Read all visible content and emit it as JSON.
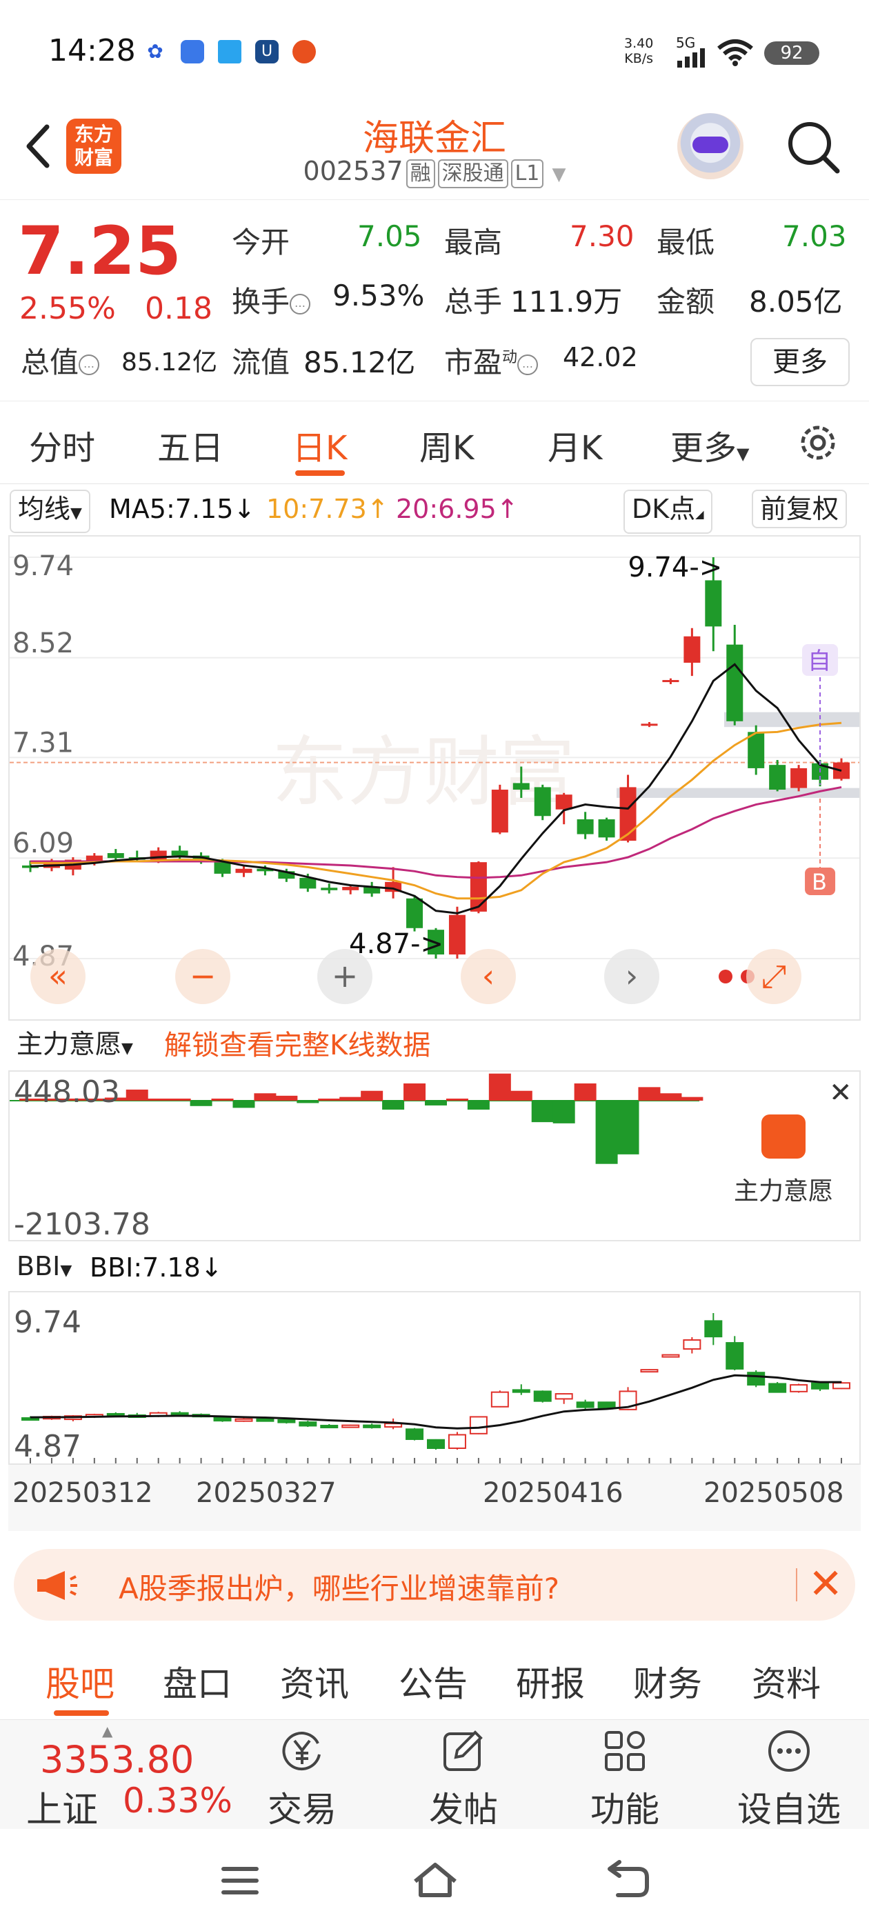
{
  "status_bar": {
    "time": "14:28",
    "net_speed": "3.40",
    "net_unit": "KB/s",
    "network": "5G",
    "battery": "92"
  },
  "header": {
    "logo_text": "东方财富",
    "stock_name": "海联金汇",
    "stock_code": "002537",
    "tags": [
      "融",
      "深股通",
      "L1"
    ]
  },
  "quote": {
    "price": "7.25",
    "change_pct": "2.55%",
    "change_amt": "0.18",
    "items": [
      {
        "label": "今开",
        "value": "7.05",
        "color": "green"
      },
      {
        "label": "最高",
        "value": "7.30",
        "color": "red"
      },
      {
        "label": "最低",
        "value": "7.03",
        "color": "green"
      },
      {
        "label": "换手",
        "value": "9.53%",
        "color": "black"
      },
      {
        "label": "总手",
        "value": "111.9万",
        "color": "black"
      },
      {
        "label": "金额",
        "value": "8.05亿",
        "color": "black"
      },
      {
        "label": "总值",
        "value": "85.12亿",
        "color": "black"
      },
      {
        "label": "流值",
        "value": "85.12亿",
        "color": "black"
      },
      {
        "label": "市盈",
        "value": "42.02",
        "color": "black"
      }
    ],
    "pe_superscript": "动",
    "more_label": "更多"
  },
  "period_tabs": [
    "分时",
    "五日",
    "日K",
    "周K",
    "月K",
    "更多"
  ],
  "active_period": "日K",
  "ma_row": {
    "selector": "均线",
    "ma5": "MA5:7.15",
    "ma10": "10:7.73",
    "ma20": "20:6.95",
    "dk_label": "DK点",
    "adjust_label": "前复权"
  },
  "colors": {
    "up": "#e0302a",
    "down": "#1f9a2a",
    "accent": "#f2581e",
    "ma5": "#111111",
    "ma10": "#f0a020",
    "ma20": "#c0287a"
  },
  "kline": {
    "y_labels": [
      "9.74",
      "8.52",
      "7.31",
      "6.09",
      "4.87"
    ],
    "high_marker": "9.74->",
    "low_marker": "4.87->",
    "watermark": "东方财富",
    "marker_zi": "自",
    "marker_b": "B",
    "controls": [
      "«",
      "−",
      "+",
      "‹",
      "›",
      "⤢"
    ]
  },
  "flow": {
    "selector": "主力意愿",
    "unlock_text": "解锁查看完整K线数据",
    "top_value": "448.03",
    "bottom_value": "-2103.78",
    "side_label": "主力意愿"
  },
  "bbi": {
    "selector": "BBI",
    "value": "BBI:7.18",
    "top_value": "9.74",
    "bottom_value": "4.87"
  },
  "dates": [
    "20250312",
    "20250327",
    "20250416",
    "20250508"
  ],
  "banner": {
    "text": "A股季报出炉，哪些行业增速靠前?"
  },
  "bottom_tabs": [
    "股吧",
    "盘口",
    "资讯",
    "公告",
    "研报",
    "财务",
    "资料"
  ],
  "index": {
    "value": "3353.80",
    "name": "上证",
    "change_pct": "0.33%"
  },
  "bottom_nav": [
    "交易",
    "发帖",
    "功能",
    "设自选"
  ],
  "chart_data": {
    "type": "candlestick",
    "ylim": [
      4.87,
      9.74
    ],
    "candles": [
      {
        "o": 6.0,
        "h": 6.06,
        "l": 5.92,
        "c": 5.97
      },
      {
        "o": 5.97,
        "h": 6.08,
        "l": 5.93,
        "c": 6.05
      },
      {
        "o": 5.95,
        "h": 6.1,
        "l": 5.88,
        "c": 6.07
      },
      {
        "o": 6.06,
        "h": 6.15,
        "l": 6.0,
        "c": 6.12
      },
      {
        "o": 6.15,
        "h": 6.2,
        "l": 6.06,
        "c": 6.09
      },
      {
        "o": 6.1,
        "h": 6.18,
        "l": 6.04,
        "c": 6.07
      },
      {
        "o": 6.07,
        "h": 6.22,
        "l": 6.03,
        "c": 6.18
      },
      {
        "o": 6.18,
        "h": 6.24,
        "l": 6.08,
        "c": 6.12
      },
      {
        "o": 6.12,
        "h": 6.16,
        "l": 6.02,
        "c": 6.06
      },
      {
        "o": 6.05,
        "h": 6.08,
        "l": 5.86,
        "c": 5.9
      },
      {
        "o": 5.91,
        "h": 6.0,
        "l": 5.86,
        "c": 5.96
      },
      {
        "o": 5.96,
        "h": 6.0,
        "l": 5.88,
        "c": 5.93
      },
      {
        "o": 5.93,
        "h": 5.96,
        "l": 5.8,
        "c": 5.84
      },
      {
        "o": 5.85,
        "h": 5.9,
        "l": 5.68,
        "c": 5.72
      },
      {
        "o": 5.73,
        "h": 5.78,
        "l": 5.66,
        "c": 5.7
      },
      {
        "o": 5.7,
        "h": 5.76,
        "l": 5.65,
        "c": 5.74
      },
      {
        "o": 5.74,
        "h": 5.8,
        "l": 5.62,
        "c": 5.66
      },
      {
        "o": 5.68,
        "h": 5.98,
        "l": 5.6,
        "c": 5.8
      },
      {
        "o": 5.6,
        "h": 5.64,
        "l": 5.2,
        "c": 5.24
      },
      {
        "o": 5.22,
        "h": 5.24,
        "l": 4.87,
        "c": 4.92
      },
      {
        "o": 4.92,
        "h": 5.5,
        "l": 4.87,
        "c": 5.4
      },
      {
        "o": 5.44,
        "h": 6.05,
        "l": 5.42,
        "c": 6.04
      },
      {
        "o": 6.4,
        "h": 6.98,
        "l": 6.38,
        "c": 6.92
      },
      {
        "o": 7.0,
        "h": 7.2,
        "l": 6.82,
        "c": 6.92
      },
      {
        "o": 6.95,
        "h": 6.98,
        "l": 6.55,
        "c": 6.6
      },
      {
        "o": 6.68,
        "h": 6.88,
        "l": 6.5,
        "c": 6.86
      },
      {
        "o": 6.56,
        "h": 6.65,
        "l": 6.32,
        "c": 6.38
      },
      {
        "o": 6.56,
        "h": 6.58,
        "l": 6.3,
        "c": 6.34
      },
      {
        "o": 6.3,
        "h": 7.1,
        "l": 6.28,
        "c": 6.95
      },
      {
        "o": 7.7,
        "h": 7.74,
        "l": 7.68,
        "c": 7.72
      },
      {
        "o": 8.23,
        "h": 8.27,
        "l": 8.2,
        "c": 8.25
      },
      {
        "o": 8.46,
        "h": 8.88,
        "l": 8.3,
        "c": 8.78
      },
      {
        "o": 9.46,
        "h": 9.74,
        "l": 8.6,
        "c": 8.9
      },
      {
        "o": 8.68,
        "h": 8.92,
        "l": 7.7,
        "c": 7.75
      },
      {
        "o": 7.62,
        "h": 7.7,
        "l": 7.1,
        "c": 7.18
      },
      {
        "o": 7.22,
        "h": 7.28,
        "l": 6.9,
        "c": 6.92
      },
      {
        "o": 6.94,
        "h": 7.22,
        "l": 6.9,
        "c": 7.18
      },
      {
        "o": 7.24,
        "h": 7.28,
        "l": 6.96,
        "c": 7.04
      },
      {
        "o": 7.05,
        "h": 7.3,
        "l": 7.03,
        "c": 7.25
      }
    ],
    "ma5": [
      5.99,
      6.0,
      6.01,
      6.03,
      6.06,
      6.08,
      6.1,
      6.11,
      6.1,
      6.05,
      6.0,
      5.97,
      5.92,
      5.86,
      5.8,
      5.76,
      5.74,
      5.72,
      5.63,
      5.45,
      5.42,
      5.5,
      5.75,
      6.08,
      6.39,
      6.67,
      6.74,
      6.71,
      6.69,
      6.96,
      7.32,
      7.75,
      8.24,
      8.44,
      8.12,
      7.91,
      7.52,
      7.22,
      7.15
    ],
    "ma10": [
      6.03,
      6.03,
      6.03,
      6.04,
      6.05,
      6.05,
      6.06,
      6.07,
      6.07,
      6.06,
      6.05,
      6.03,
      6.01,
      5.98,
      5.94,
      5.9,
      5.86,
      5.82,
      5.76,
      5.66,
      5.6,
      5.6,
      5.62,
      5.7,
      5.9,
      6.04,
      6.11,
      6.21,
      6.38,
      6.6,
      6.84,
      7.04,
      7.27,
      7.46,
      7.61,
      7.62,
      7.67,
      7.71,
      7.73
    ],
    "ma20": [
      6.05,
      6.05,
      6.05,
      6.05,
      6.05,
      6.05,
      6.05,
      6.05,
      6.05,
      6.05,
      6.04,
      6.04,
      6.03,
      6.02,
      6.01,
      6.0,
      5.98,
      5.96,
      5.93,
      5.88,
      5.86,
      5.85,
      5.86,
      5.88,
      5.93,
      5.98,
      6.01,
      6.04,
      6.1,
      6.2,
      6.33,
      6.44,
      6.57,
      6.66,
      6.74,
      6.79,
      6.84,
      6.9,
      6.95
    ],
    "support_bands": [
      [
        7.68,
        7.86
      ],
      [
        6.82,
        6.94
      ]
    ],
    "flow_values": [
      0,
      0,
      0,
      0,
      50,
      180,
      0,
      20,
      -90,
      0,
      -120,
      120,
      80,
      -40,
      0,
      60,
      160,
      -150,
      280,
      -80,
      0,
      -150,
      440,
      160,
      -360,
      -380,
      280,
      -1060,
      -900,
      220,
      120,
      60,
      0,
      -2103.78
    ]
  }
}
